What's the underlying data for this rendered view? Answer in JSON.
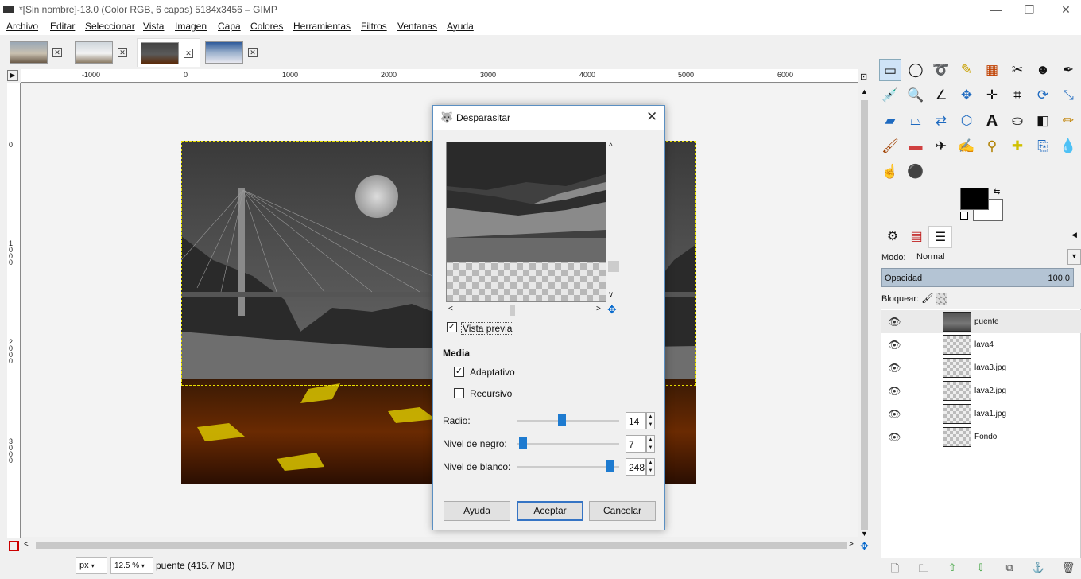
{
  "window": {
    "title": "*[Sin nombre]-13.0 (Color RGB, 6 capas) 5184x3456 – GIMP",
    "minimize": "—",
    "maximize": "❐",
    "close": "✕"
  },
  "menu": [
    "Archivo",
    "Editar",
    "Seleccionar",
    "Vista",
    "Imagen",
    "Capa",
    "Colores",
    "Herramientas",
    "Filtros",
    "Ventanas",
    "Ayuda"
  ],
  "image_tabs": [
    {
      "close": "✕"
    },
    {
      "close": "✕"
    },
    {
      "close": "✕",
      "active": true
    },
    {
      "close": "✕"
    }
  ],
  "ruler": {
    "h_labels": [
      "-1000",
      "0",
      "1000",
      "2000",
      "3000",
      "4000",
      "5000",
      "6000"
    ],
    "v_labels": [
      "0",
      "1\n0\n0\n0",
      "2\n0\n0\n0",
      "3\n0\n0\n0"
    ]
  },
  "status": {
    "unit": "px",
    "zoom": "12.5 %",
    "text": "puente (415.7 MB)"
  },
  "toolbox": {
    "fg_color": "#000000",
    "bg_color": "#ffffff"
  },
  "layers_panel": {
    "mode_label": "Modo:",
    "mode_value": "Normal",
    "opacity_label": "Opacidad",
    "opacity_value": "100.0",
    "lock_label": "Bloquear:",
    "layers": [
      {
        "name": "puente",
        "selected": true
      },
      {
        "name": "lava4"
      },
      {
        "name": "lava3.jpg"
      },
      {
        "name": "lava2.jpg"
      },
      {
        "name": "lava1.jpg"
      },
      {
        "name": "Fondo"
      }
    ]
  },
  "dialog": {
    "title": "Desparasitar",
    "preview_label": "Vista previa",
    "preview_checked": true,
    "section": "Media",
    "adaptive_label": "Adaptativo",
    "adaptive_checked": true,
    "recursive_label": "Recursivo",
    "recursive_checked": false,
    "radius_label": "Radio:",
    "radius_value": "14",
    "black_label": "Nivel de negro:",
    "black_value": "7",
    "white_label": "Nivel de blanco:",
    "white_value": "248",
    "help_button": "Ayuda",
    "ok_button": "Aceptar",
    "cancel_button": "Cancelar"
  }
}
